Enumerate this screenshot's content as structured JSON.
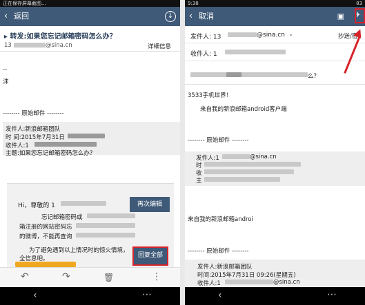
{
  "left": {
    "status_text": "正在保存屏幕截图...",
    "back_label": "返回",
    "subject": "转发:如果您忘记邮箱密码怎么办？",
    "sender_suffix": "@sina.cn",
    "sender_prefix": "13",
    "detail_link": "详细信息",
    "body_dash": "--",
    "body_char": "沫",
    "divider_text": "-------- 原始邮件 --------",
    "quote_from": "发件人:新浪邮箱团队",
    "quote_time": "时  间:2015年7月31日",
    "quote_to": "收件人:1",
    "quote_subject": "主题:如果您忘记邮箱密码怎么办？",
    "card_greeting": "Hi，尊敬的 1",
    "card_line1": "忘记邮箱密码或",
    "card_line2": "箱注册的网站密码忘",
    "card_line3": "的微博，不能再查询",
    "card_line4": "为了避免遇到以上情况时的惊火情境，",
    "card_line5": "全信息吧。",
    "reedit_label": "再次编辑",
    "replyall_label": "回复全部"
  },
  "right": {
    "status_time": "9:38",
    "status_right": "83",
    "cancel_label": "取消",
    "from_label": "发件人: 13",
    "from_suffix": "@sina.cn",
    "cc_label": "抄送/密",
    "to_label": "收件人: 1",
    "subject_suffix": "么？",
    "body_sign": "3533手机世界！",
    "from_android": "来自我的新浪邮箱android客户端",
    "divider_text": "-------- 原始邮件 --------",
    "inner_sender_label": "发件人:1",
    "inner_sender_suffix": "@sina.cn",
    "inner_time": "时",
    "inner_to": "收",
    "inner_subject": "主",
    "from_android2": "来自我的新浪邮箱androi",
    "divider_text2": "-------- 原始邮件 --------",
    "bottom_from": "发件人:新浪邮箱团队",
    "bottom_time": "时间:2015年7月31日 09:26(星期五)",
    "bottom_to": "收件人:1",
    "bottom_to_suffix": "@sina.cn"
  },
  "icons": {
    "back": "‹",
    "nav_back": "‹",
    "nav_menu": "⋯",
    "reply": "↶",
    "forward": "↷",
    "trash": "🗑",
    "more": "⋮",
    "download": "↓",
    "save": "▣",
    "send": "✈"
  },
  "colors": {
    "toolbar": "#3f5a78",
    "highlight": "#d8232a",
    "accent": "#f0a820"
  }
}
